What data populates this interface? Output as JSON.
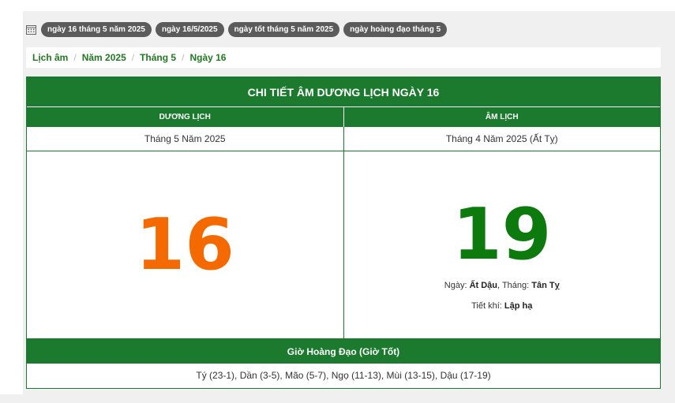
{
  "tags": [
    "ngày 16 tháng 5 năm 2025",
    "ngày 16/5/2025",
    "ngày tốt tháng 5 năm 2025",
    "ngày hoàng đạo tháng 5"
  ],
  "breadcrumb": [
    "Lịch âm",
    "Năm 2025",
    "Tháng 5",
    "Ngày 16"
  ],
  "card": {
    "title": "CHI TIẾT ÂM DƯƠNG LỊCH NGÀY 16",
    "solar_header": "DƯƠNG LỊCH",
    "lunar_header": "ÂM LỊCH",
    "solar_month": "Tháng 5 Năm 2025",
    "lunar_month": "Tháng 4 Năm 2025 (Ất Tỵ)",
    "solar_day": "16",
    "lunar_day": "19",
    "day_label": "Ngày:",
    "day_value": "Ất Dậu",
    "month_label": ", Tháng:",
    "month_value": "Tân Tỵ",
    "tietkhi_label": "Tiết khí:",
    "tietkhi_value": "Lập hạ",
    "gio_title": "Giờ Hoàng Đạo (Giờ Tốt)",
    "gio_list": "Tý (23-1), Dần (3-5), Mão (5-7), Ngọ (11-13), Mùi (13-15), Dậu (17-19)"
  },
  "colors": {
    "green": "#1b7a2d",
    "solar": "#f56a00",
    "lunar": "#0d7a0d",
    "tag": "#5b5b5b"
  }
}
